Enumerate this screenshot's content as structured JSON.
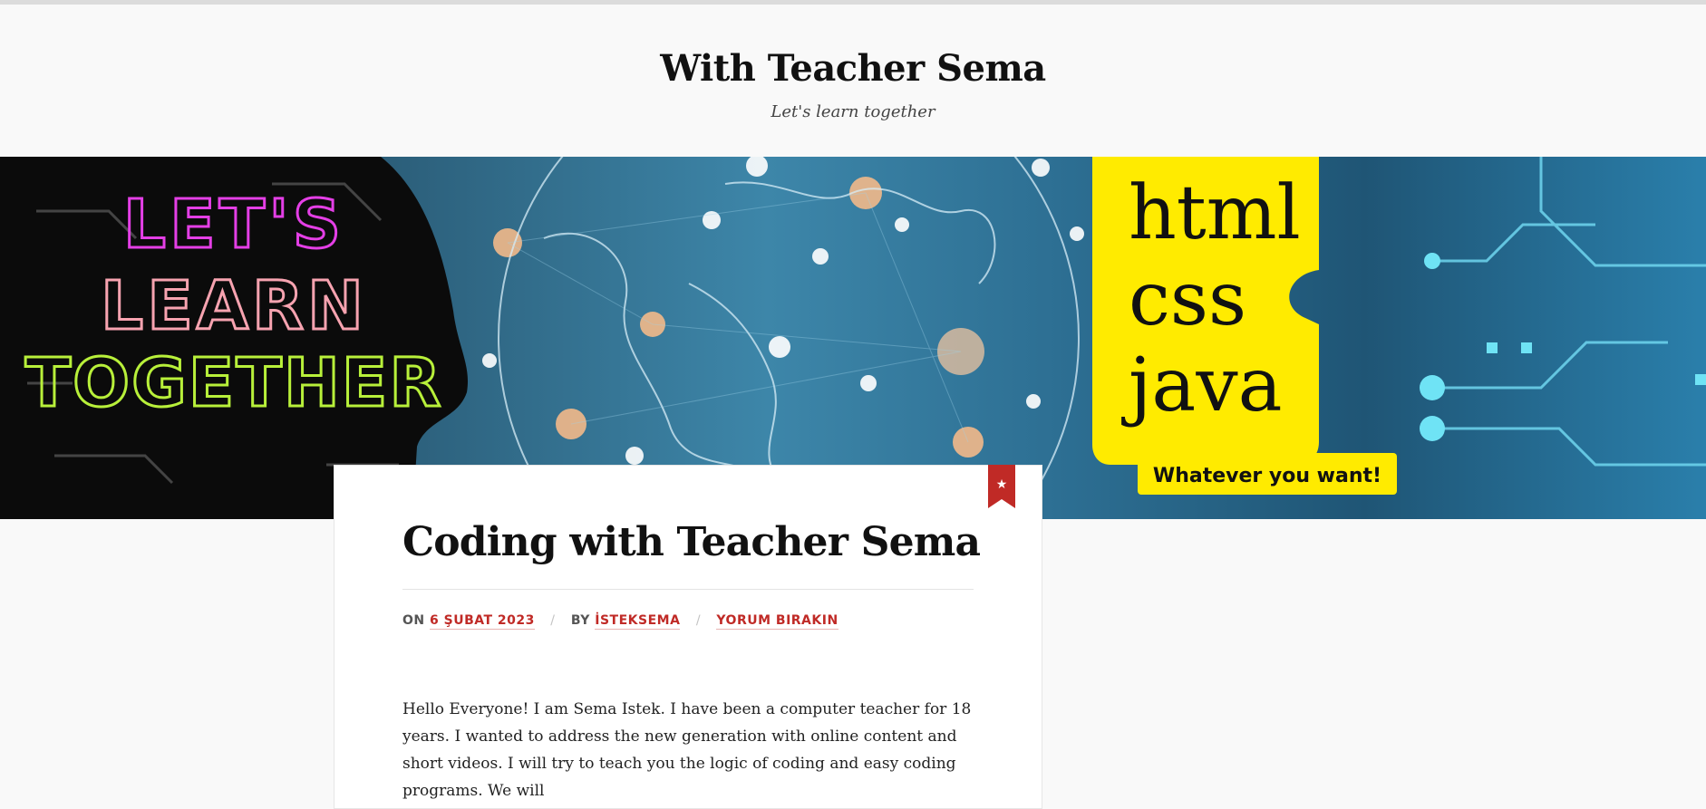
{
  "site": {
    "title": "With Teacher Sema",
    "tagline": "Let's learn together"
  },
  "hero": {
    "left_text": [
      "LET'S",
      "LEARN",
      "TOGETHER"
    ],
    "right_lines": [
      "html",
      "css",
      "java"
    ],
    "badge": "Whatever you want!"
  },
  "post": {
    "title": "Coding with Teacher Sema",
    "meta": {
      "on_label": "ON",
      "date": "6 ŞUBAT 2023",
      "by_label": "BY",
      "author": "İSTEKSEMA",
      "comment": "YORUM BIRAKIN",
      "sep": "/"
    },
    "body": "Hello Everyone! I am Sema Istek. I have been a computer teacher for 18 years. I wanted to address the new generation with online content and short videos. I will try to teach you the logic of coding and easy coding programs. We will"
  },
  "colors": {
    "accent": "#c02a26",
    "background": "#f9f9f9",
    "hero_yellow": "#ffeb00"
  },
  "icons": {
    "ribbon": "star-bookmark-icon"
  }
}
